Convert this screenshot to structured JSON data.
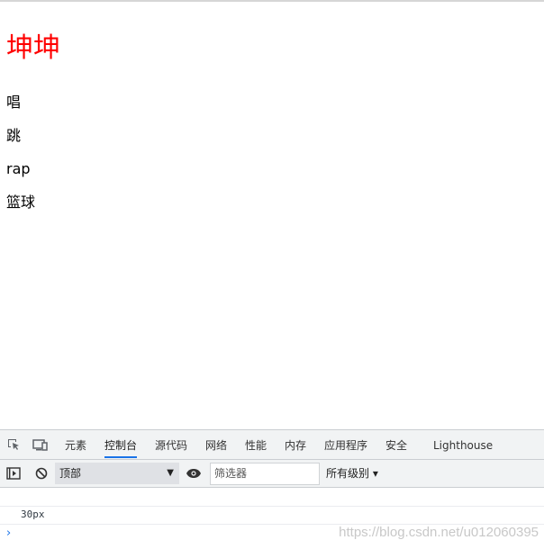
{
  "page": {
    "title": "坤坤",
    "items": [
      "唱",
      "跳",
      "rap",
      "篮球"
    ]
  },
  "devtools": {
    "tabs": [
      {
        "label": "元素",
        "active": false
      },
      {
        "label": "控制台",
        "active": true
      },
      {
        "label": "源代码",
        "active": false
      },
      {
        "label": "网络",
        "active": false
      },
      {
        "label": "性能",
        "active": false
      },
      {
        "label": "内存",
        "active": false
      },
      {
        "label": "应用程序",
        "active": false
      },
      {
        "label": "安全",
        "active": false
      },
      {
        "label": "Lighthouse",
        "active": false
      }
    ],
    "toolbar": {
      "context": "顶部",
      "filter_placeholder": "筛选器",
      "levels": "所有级别 ▾"
    },
    "console": {
      "log": "30px",
      "prompt": "›"
    },
    "watermark": "https://blog.csdn.net/u012060395",
    "colors": {
      "accent": "#1a73e8",
      "title": "#ff0000"
    }
  }
}
